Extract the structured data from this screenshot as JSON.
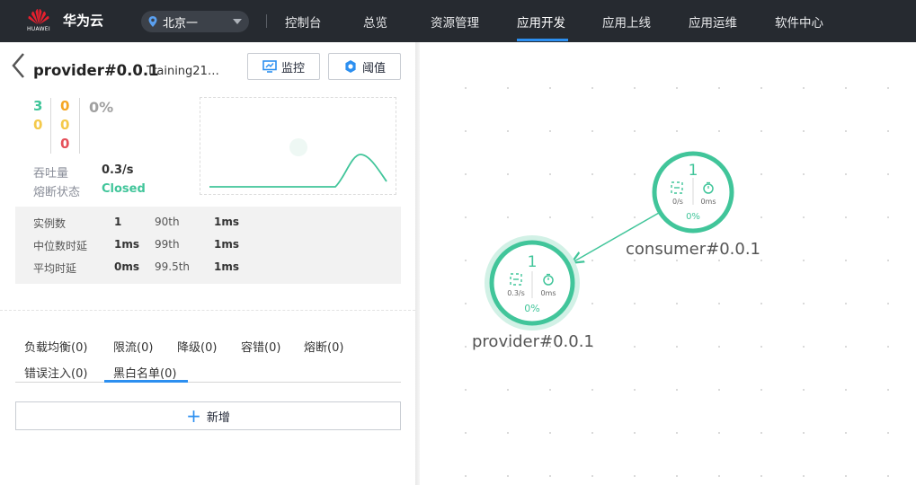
{
  "header": {
    "logo_text": "HUAWEI",
    "brand": "华为云",
    "region": "北京一",
    "nav": [
      {
        "label": "控制台"
      },
      {
        "label": "总览"
      },
      {
        "label": "资源管理"
      },
      {
        "label": "应用开发"
      },
      {
        "label": "应用上线"
      },
      {
        "label": "应用运维"
      },
      {
        "label": "软件中心"
      }
    ],
    "active_nav": "应用开发"
  },
  "panel": {
    "title": "provider#0.0.1",
    "subtitle": "Training21…",
    "monitor_label": "监控",
    "threshold_label": "阈值",
    "counts": {
      "col1": [
        "3",
        "0"
      ],
      "col2": [
        "0",
        "0",
        "0"
      ],
      "rate": "0%"
    },
    "throughput_label": "吞吐量",
    "throughput_value": "0.3/s",
    "circuit_label": "熔断状态",
    "circuit_value": "Closed",
    "stats": [
      {
        "label": "实例数",
        "value": "1",
        "pct_label": "90th",
        "pct_value": "1ms"
      },
      {
        "label": "中位数时延",
        "value": "1ms",
        "pct_label": "99th",
        "pct_value": "1ms"
      },
      {
        "label": "平均时延",
        "value": "0ms",
        "pct_label": "99.5th",
        "pct_value": "1ms"
      }
    ],
    "tabs": [
      {
        "label": "负载均衡(0)"
      },
      {
        "label": "限流(0)"
      },
      {
        "label": "降级(0)"
      },
      {
        "label": "容错(0)"
      },
      {
        "label": "熔断(0)"
      },
      {
        "label": "错误注入(0)"
      },
      {
        "label": "黑白名单(0)"
      }
    ],
    "active_tab": "黑白名单(0)",
    "add_label": "新增"
  },
  "graph": {
    "nodes": [
      {
        "name": "consumer#0.0.1",
        "instances": "1",
        "rate": "0/s",
        "latency": "0ms",
        "error": "0%"
      },
      {
        "name": "provider#0.0.1",
        "instances": "1",
        "rate": "0.3/s",
        "latency": "0ms",
        "error": "0%"
      }
    ]
  },
  "colors": {
    "accent": "#2c8ff0",
    "healthy": "#41c59a",
    "warning": "#f5a623",
    "error": "#e5505a",
    "caution": "#f4c94a",
    "nav_bg": "#262a30"
  }
}
